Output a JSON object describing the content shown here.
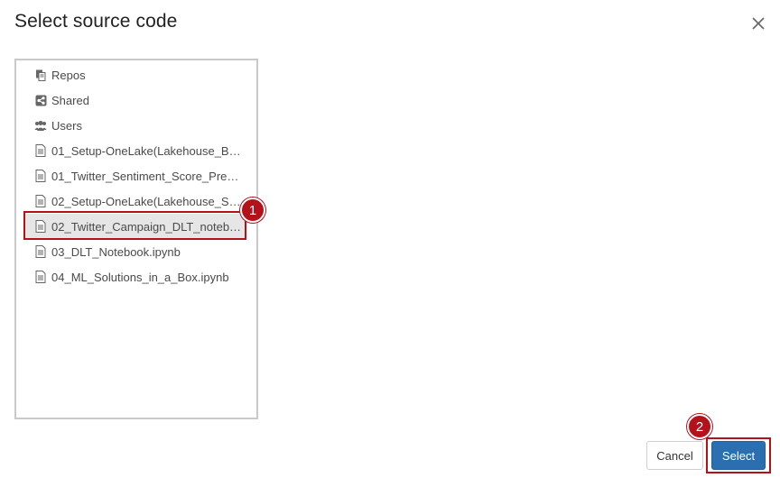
{
  "dialog": {
    "title": "Select source code",
    "close_icon": "close-icon"
  },
  "tree": {
    "items": [
      {
        "label": "Repos",
        "icon": "repos-icon"
      },
      {
        "label": "Shared",
        "icon": "shared-icon"
      },
      {
        "label": "Users",
        "icon": "users-icon"
      },
      {
        "label": "01_Setup-OneLake(Lakehouse_Bro...",
        "icon": "notebook-file-icon"
      },
      {
        "label": "01_Twitter_Sentiment_Score_Pred_...",
        "icon": "notebook-file-icon"
      },
      {
        "label": "02_Setup-OneLake(Lakehouse_Silv...",
        "icon": "notebook-file-icon"
      },
      {
        "label": "02_Twitter_Campaign_DLT_notebo...",
        "icon": "notebook-file-icon",
        "selected": true
      },
      {
        "label": "03_DLT_Notebook.ipynb",
        "icon": "notebook-file-icon"
      },
      {
        "label": "04_ML_Solutions_in_a_Box.ipynb",
        "icon": "notebook-file-icon"
      }
    ]
  },
  "callouts": {
    "step1": "1",
    "step2": "2"
  },
  "footer": {
    "cancel_label": "Cancel",
    "select_label": "Select"
  },
  "colors": {
    "primary": "#2b6fb0",
    "callout": "#b3121a",
    "selected_row": "#e6e6e6"
  }
}
